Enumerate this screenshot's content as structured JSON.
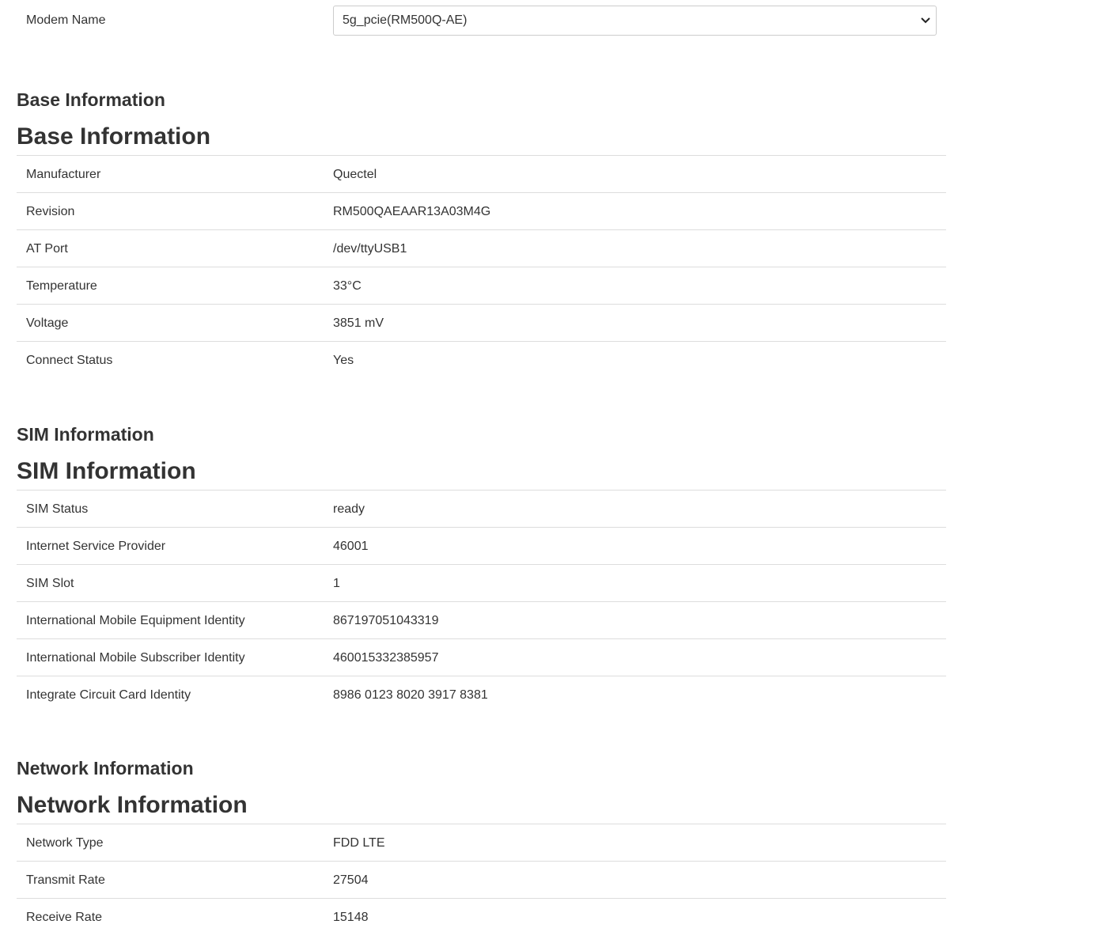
{
  "modem": {
    "label": "Modem Name",
    "selected": "5g_pcie(RM500Q-AE)"
  },
  "base": {
    "small_title": "Base Information",
    "title": "Base Information",
    "rows": [
      {
        "label": "Manufacturer",
        "value": "Quectel"
      },
      {
        "label": "Revision",
        "value": "RM500QAEAAR13A03M4G"
      },
      {
        "label": "AT Port",
        "value": "/dev/ttyUSB1"
      },
      {
        "label": "Temperature",
        "value": "33°C"
      },
      {
        "label": "Voltage",
        "value": "3851 mV"
      },
      {
        "label": "Connect Status",
        "value": "Yes"
      }
    ]
  },
  "sim": {
    "small_title": "SIM Information",
    "title": "SIM Information",
    "rows": [
      {
        "label": "SIM Status",
        "value": "ready"
      },
      {
        "label": "Internet Service Provider",
        "value": "46001"
      },
      {
        "label": "SIM Slot",
        "value": "1"
      },
      {
        "label": "International Mobile Equipment Identity",
        "value": "867197051043319"
      },
      {
        "label": "International Mobile Subscriber Identity",
        "value": "460015332385957"
      },
      {
        "label": "Integrate Circuit Card Identity",
        "value": "8986 0123 8020 3917 8381"
      }
    ]
  },
  "network": {
    "small_title": "Network Information",
    "title": "Network Information",
    "rows": [
      {
        "label": "Network Type",
        "value": "FDD LTE"
      },
      {
        "label": "Transmit Rate",
        "value": "27504"
      },
      {
        "label": "Receive Rate",
        "value": "15148"
      }
    ]
  }
}
